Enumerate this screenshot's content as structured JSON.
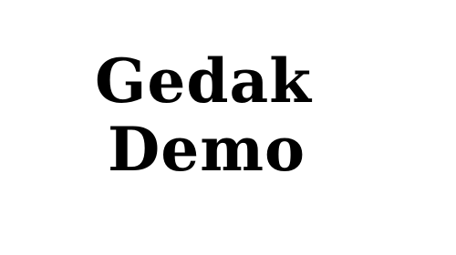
{
  "specimen": {
    "line1": "Gedak",
    "line2": "Demo"
  },
  "colors": {
    "background": "#ffffff",
    "text": "#000000"
  }
}
